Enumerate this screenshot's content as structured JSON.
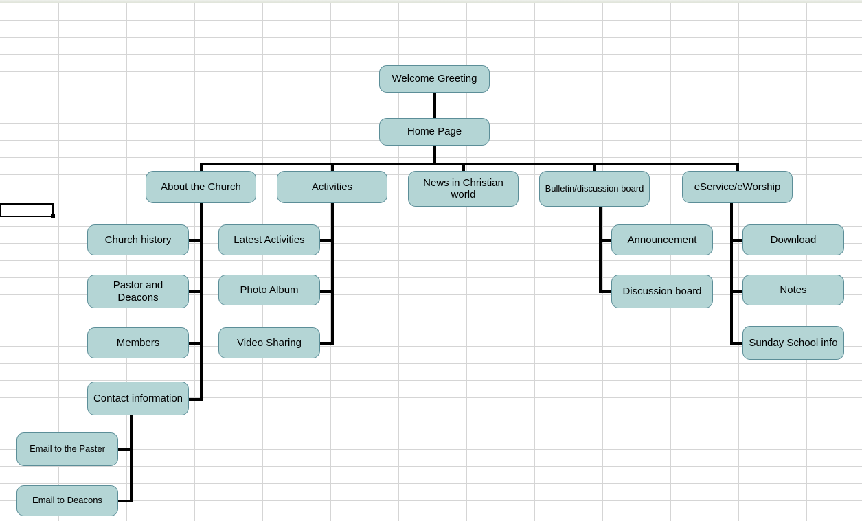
{
  "nodes": {
    "root": "Welcome Greeting",
    "home": "Home Page",
    "about": "About the Church",
    "activities": "Activities",
    "news": "News in Christian world",
    "bulletin": "Bulletin/discussion board",
    "eservice": "eService/eWorship",
    "church_history": "Church history",
    "pastor_deacons": "Pastor and Deacons",
    "members": "Members",
    "contact_info": "Contact information",
    "email_pastor": "Email to the Paster",
    "email_deacons": "Email to Deacons",
    "latest_activities": "Latest Activities",
    "photo_album": "Photo Album",
    "video_sharing": "Video Sharing",
    "announcement": "Announcement",
    "discussion_board": "Discussion board",
    "download": "Download",
    "notes": "Notes",
    "sunday_school": "Sunday School info"
  },
  "colors": {
    "node_fill": "#b4d5d5",
    "node_border": "#5c8e98",
    "connector": "#000000",
    "grid": "#d5d5d5"
  }
}
